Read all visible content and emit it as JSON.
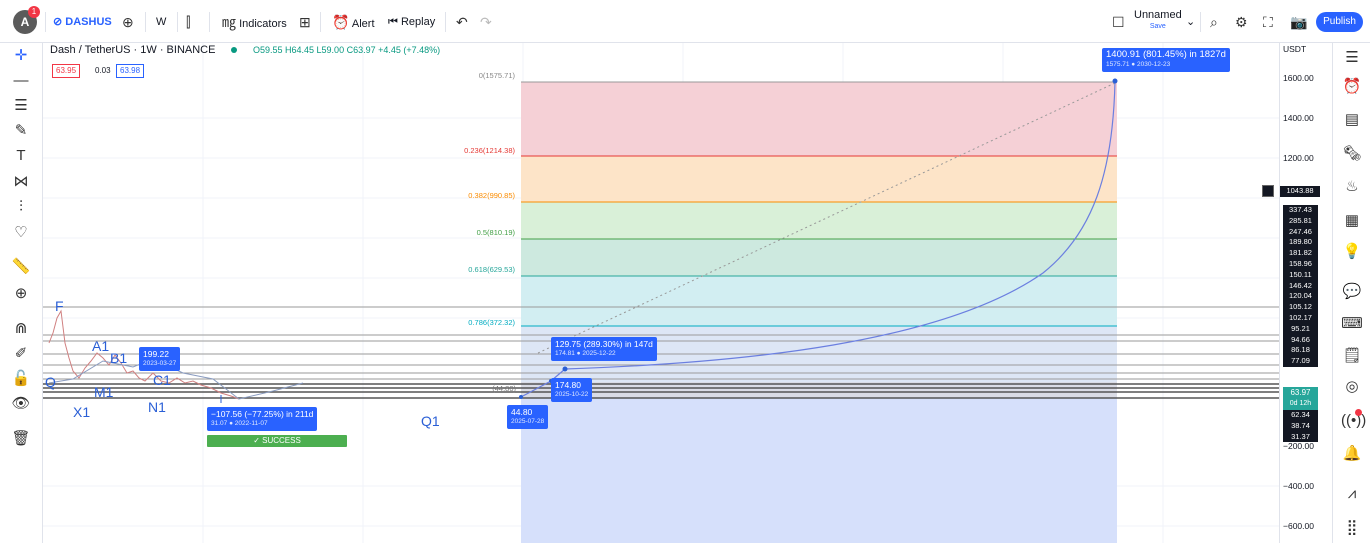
{
  "toolbar": {
    "symbol": "DASHUS",
    "interval": "W",
    "indicators": "Indicators",
    "alert": "Alert",
    "replay": "Replay",
    "layout_name": "Unnamed",
    "layout_sub": "Save",
    "publish": "Publish",
    "logo_badge": "1"
  },
  "legend": {
    "title": "Dash / TetherUS · 1W · BINANCE",
    "ohlc": "O59.55 H64.45 L59.00 C63.97 +4.45 (+7.48%)",
    "bid": "63.95",
    "spread": "0.03",
    "ask": "63.98"
  },
  "annotations": {
    "tag_start": {
      "main": "199.22",
      "sub": "2023-03-27"
    },
    "tag_drop": {
      "main": "−107.56 (−77.25%) in 211d",
      "sub": "31.07 ● 2022-11-07"
    },
    "success": "✓ SUCCESS",
    "tag_mid": {
      "main": "129.75 (289.30%) in 147d",
      "sub": "174.81 ● 2025-12-22"
    },
    "tag_low": {
      "main": "44.80",
      "sub": "2025-07-28"
    },
    "tag_p174": {
      "main": "174.80",
      "sub": "2025-10-22"
    },
    "tag_target": {
      "main": "1400.91 (801.45%) in 1827d",
      "sub": "1575.71 ● 2030-12-23"
    },
    "letters": {
      "F": "F",
      "A1": "A1",
      "B1": "B1",
      "Q": "Q",
      "M1": "M1",
      "C1": "C1",
      "X1": "X1",
      "N1": "N1",
      "Q1": "Q1"
    },
    "small_label": "(44.80)"
  },
  "fib_levels": [
    {
      "label": "0(1575.71)",
      "color": "#888888"
    },
    {
      "label": "0.236(1214.38)",
      "color": "#e53935"
    },
    {
      "label": "0.382(990.85)",
      "color": "#fb8c00"
    },
    {
      "label": "0.5(810.19)",
      "color": "#43a047"
    },
    {
      "label": "0.618(629.53)",
      "color": "#26a69a"
    },
    {
      "label": "0.786(372.32)",
      "color": "#00acc1"
    }
  ],
  "price_axis": {
    "currency": "USDT",
    "labels": [
      "1600.00",
      "1400.00",
      "1200.00",
      "−200.00",
      "−400.00",
      "−600.00"
    ],
    "current_price": "1043.88",
    "stack_labels": [
      "337.43",
      "285.81",
      "247.46",
      "189.80",
      "181.82",
      "158.96",
      "150.11",
      "146.42",
      "120.04",
      "105.12",
      "102.17",
      "95.21",
      "94.66",
      "86.18",
      "77.09"
    ],
    "green_main": "63.97",
    "green_sub": "0d 12h",
    "stack2_labels": [
      "62.34",
      "38.74",
      "31.37"
    ]
  },
  "colors": {
    "accent": "#2962ff",
    "success": "#4caf50",
    "pathline": "#7a8de0"
  }
}
